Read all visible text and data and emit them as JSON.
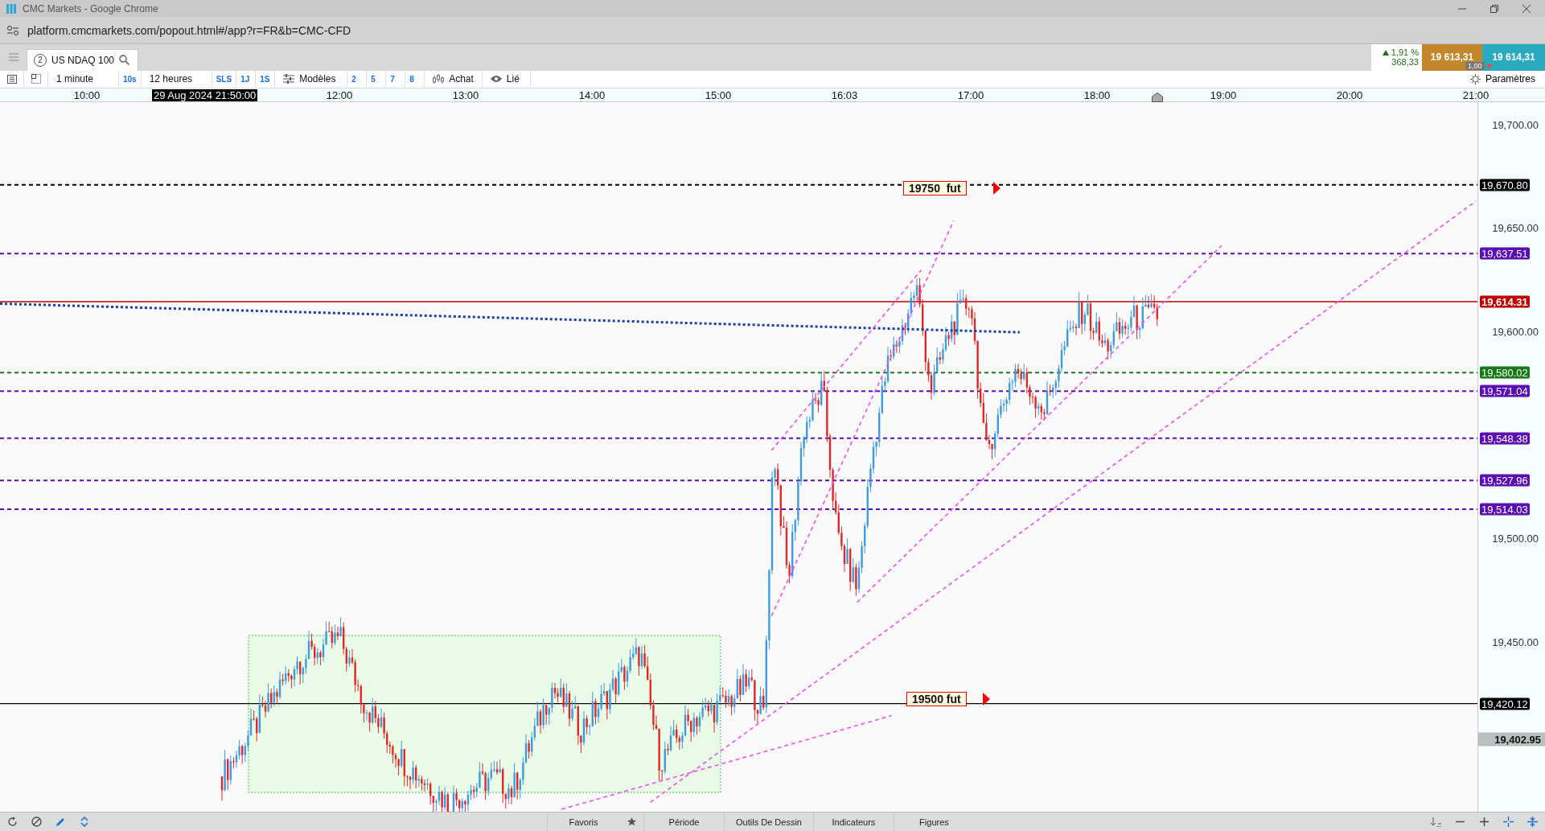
{
  "browser": {
    "title": "CMC Markets - Google Chrome",
    "url": "platform.cmcmarkets.com/popout.html#/app?r=FR&b=CMC-CFD"
  },
  "instrument_tab": {
    "badge": "2",
    "name": "US NDAQ 100"
  },
  "quote": {
    "change": "1,91 %",
    "points": "368,33",
    "sell": "19 613,31",
    "buy": "19 614,31",
    "spread": "1,00"
  },
  "toolbar": [
    {
      "kind": "menu",
      "text": "1 minute"
    },
    {
      "kind": "chip",
      "text": "10s"
    },
    {
      "kind": "menu",
      "text": "12 heures"
    },
    {
      "kind": "chip",
      "text": "SLS"
    },
    {
      "kind": "chip",
      "text": "1J"
    },
    {
      "kind": "chip",
      "text": "1S"
    },
    {
      "kind": "templates",
      "text": "Modèles"
    },
    {
      "kind": "chip",
      "text": "2"
    },
    {
      "kind": "chip",
      "text": "5"
    },
    {
      "kind": "chip",
      "text": "7"
    },
    {
      "kind": "chip",
      "text": "8"
    },
    {
      "kind": "side",
      "text": "Achat"
    },
    {
      "kind": "link",
      "text": "Lié"
    }
  ],
  "settings": "Paramètres",
  "time_axis": {
    "cursor_date": "29 Aug 2024 21:50:00",
    "labels": [
      "10:00",
      "12:00",
      "13:00",
      "14:00",
      "15:00",
      "16:03",
      "17:00",
      "18:00",
      "19:00",
      "20:00",
      "21:00"
    ]
  },
  "price_axis": {
    "ticks": [
      "19,700.00",
      "19,650.00",
      "19,600.00",
      "19,500.00",
      "19,450.00"
    ],
    "current_price": "19,402.95"
  },
  "levels": [
    {
      "price": "19,670.80",
      "color": "#000000",
      "kind": "dashed",
      "note": "19750  fut"
    },
    {
      "price": "19,637.51",
      "color": "#5b0fb3",
      "kind": "dashed"
    },
    {
      "price": "19,614.31",
      "color": "#c00000",
      "kind": "solid"
    },
    {
      "price": "19,580.02",
      "color": "#147a14",
      "kind": "dashed"
    },
    {
      "price": "19,571.04",
      "color": "#5b0fb3",
      "kind": "dashed"
    },
    {
      "price": "19,548.38",
      "color": "#5b0fb3",
      "kind": "dashed"
    },
    {
      "price": "19,527.96",
      "color": "#5b0fb3",
      "kind": "dashed"
    },
    {
      "price": "19,514.03",
      "color": "#5b0fb3",
      "kind": "dashed"
    },
    {
      "price": "19,420.12",
      "color": "#000000",
      "kind": "solid",
      "note": "19500 fut"
    }
  ],
  "bottom_bar": {
    "tabs": [
      "Favoris",
      "Période",
      "Outils De Dessin",
      "Indicateurs",
      "Figures"
    ]
  }
}
